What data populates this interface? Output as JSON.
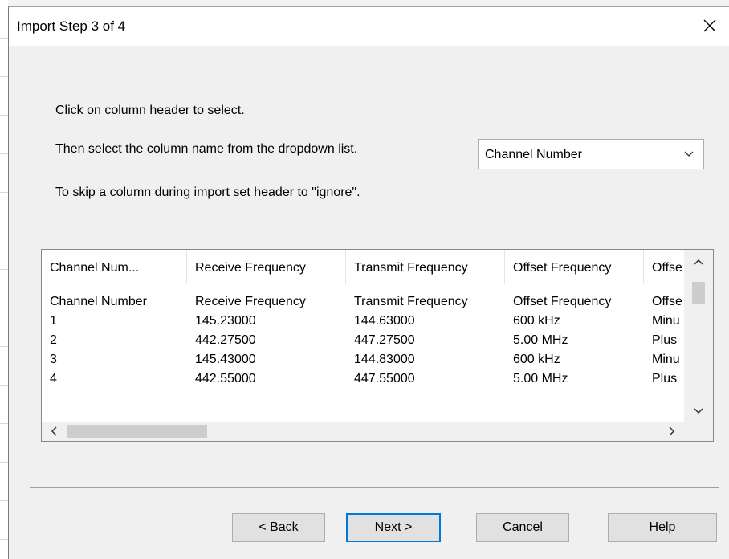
{
  "dialog": {
    "title": "Import Step 3 of 4",
    "instructions": {
      "line1": "Click on column header to select.",
      "line2": "Then select the column name from the dropdown list.",
      "line3": "To skip a column during import set header to \"ignore\"."
    },
    "column_select": {
      "value": "Channel Number"
    }
  },
  "grid": {
    "headers": [
      "Channel Num...",
      "Receive Frequency",
      "Transmit Frequency",
      "Offset Frequency",
      "Offse"
    ],
    "rows": [
      [
        "Channel Number",
        "Receive Frequency",
        "Transmit Frequency",
        "Offset Frequency",
        "Offse"
      ],
      [
        "1",
        "145.23000",
        "144.63000",
        "600 kHz",
        "Minu"
      ],
      [
        "2",
        "442.27500",
        "447.27500",
        "5.00 MHz",
        "Plus"
      ],
      [
        "3",
        "145.43000",
        "144.83000",
        "600 kHz",
        "Minu"
      ],
      [
        "4",
        "442.55000",
        "447.55000",
        "5.00 MHz",
        "Plus"
      ]
    ]
  },
  "buttons": {
    "back": "< Back",
    "next": "Next >",
    "cancel": "Cancel",
    "help": "Help"
  },
  "icons": {
    "close": "close-icon",
    "dropdown": "chevron-down-icon",
    "scroll_up": "arrow-up-icon",
    "scroll_down": "arrow-down-icon",
    "scroll_left": "arrow-left-icon",
    "scroll_right": "arrow-right-icon"
  }
}
